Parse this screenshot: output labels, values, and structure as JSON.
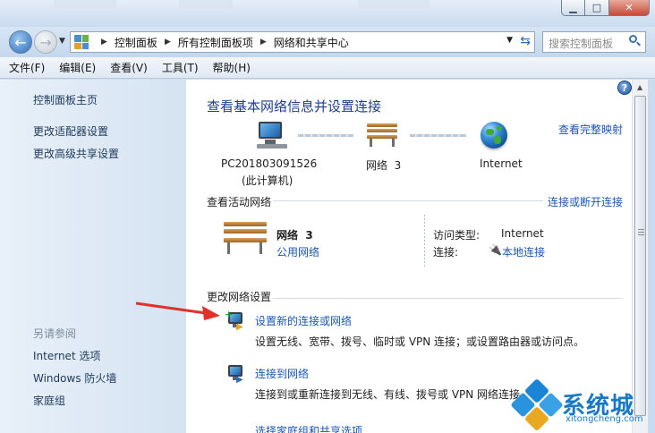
{
  "window": {
    "minimize_glyph": "▁",
    "maximize_glyph": "□",
    "close_glyph": "✕"
  },
  "navigation": {
    "breadcrumbs": [
      "控制面板",
      "所有控制面板项",
      "网络和共享中心"
    ],
    "search_placeholder": "搜索控制面板"
  },
  "menu": {
    "items": [
      "文件(F)",
      "编辑(E)",
      "查看(V)",
      "工具(T)",
      "帮助(H)"
    ]
  },
  "sidebar": {
    "links": [
      "控制面板主页",
      "更改适配器设置",
      "更改高级共享设置"
    ],
    "see_also_title": "另请参阅",
    "see_also": [
      "Internet 选项",
      "Windows 防火墙",
      "家庭组"
    ]
  },
  "main": {
    "heading": "查看基本网络信息并设置连接",
    "view_full_map": "查看完整映射",
    "map": {
      "computer_name": "PC201803091526",
      "computer_sub": "(此计算机)",
      "network": "网络  3",
      "internet": "Internet"
    },
    "active_networks": {
      "title": "查看活动网络",
      "connect_disconnect": "连接或断开连接",
      "network_name": "网络  3",
      "network_type": "公用网络",
      "access_type_label": "访问类型:",
      "access_type_value": "Internet",
      "connections_label": "连接:",
      "connections_value": "本地连接"
    },
    "change_settings": {
      "title": "更改网络设置",
      "tasks": [
        {
          "title": "设置新的连接或网络",
          "desc": "设置无线、宽带、拨号、临时或 VPN 连接；或设置路由器或访问点。"
        },
        {
          "title": "连接到网络",
          "desc": "连接到或重新连接到无线、有线、拨号或 VPN 网络连接。"
        },
        {
          "title": "选择家庭组和共享选项",
          "desc": ""
        }
      ]
    }
  },
  "watermark": {
    "text": "系统城",
    "url": "xitongcheng.com"
  },
  "colors": {
    "link": "#1b56b4",
    "heading": "#1e3d8f",
    "arrow": "#e0322b",
    "watermark": "#1778c5"
  }
}
